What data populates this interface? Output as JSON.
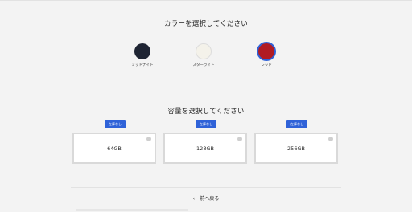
{
  "color_section": {
    "title": "カラーを選択してください",
    "options": [
      {
        "label": "ミッドナイト",
        "color": "#1e2433",
        "selected": false
      },
      {
        "label": "スターライト",
        "color": "#f4f2ea",
        "selected": false
      },
      {
        "label": "レッド",
        "color": "#b11b23",
        "selected": true
      }
    ]
  },
  "capacity_section": {
    "title": "容量を選択してください",
    "options": [
      {
        "badge": "在庫なし",
        "label": "64GB"
      },
      {
        "badge": "在庫なし",
        "label": "128GB"
      },
      {
        "badge": "在庫なし",
        "label": "256GB"
      }
    ]
  },
  "nav": {
    "back_label": "前へ戻る",
    "back_icon": "chevron-left-icon"
  },
  "colors": {
    "accent": "#2f62d8",
    "badge_text": "#ffffff"
  }
}
